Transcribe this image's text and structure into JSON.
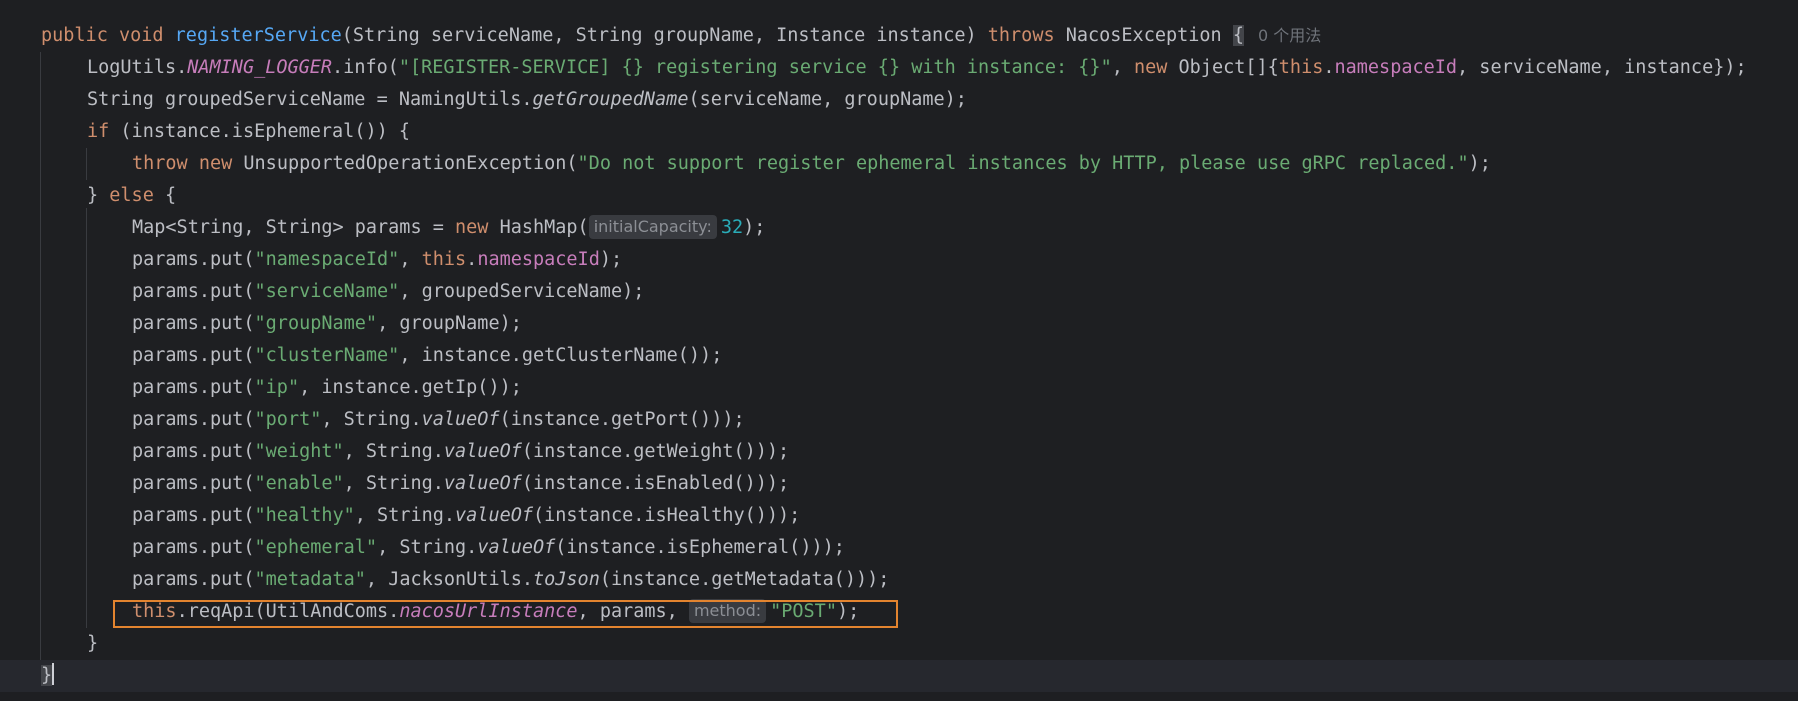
{
  "code": {
    "l1": {
      "public": "public",
      "void": "void",
      "method_name": "registerService",
      "params": "(String serviceName, String groupName, Instance instance)",
      "throws": "throws",
      "exception": "NacosException",
      "brace": "{",
      "usages": "0 个用法"
    },
    "l2": {
      "cls": "LogUtils.",
      "field": "NAMING_LOGGER",
      "call": ".info(",
      "str": "\"[REGISTER-SERVICE] {} registering service {} with instance: {}\"",
      "sep": ", ",
      "new": "new",
      "obj": "Object[]{",
      "this": "this",
      "dot": ".",
      "ns": "namespaceId",
      "rest": ", serviceName, instance});"
    },
    "l3": {
      "pre": "String groupedServiceName = NamingUtils.",
      "method": "getGroupedName",
      "post": "(serviceName, groupName);"
    },
    "l4": {
      "if": "if",
      "rest": "(instance.isEphemeral()) {"
    },
    "l5": {
      "throw": "throw",
      "new": "new",
      "exc": "UnsupportedOperationException(",
      "str": "\"Do not support register ephemeral instances by HTTP, please use gRPC replaced.\"",
      "end": ");"
    },
    "l6": {
      "brace": "}",
      "else": "else",
      "open": "{"
    },
    "l7": {
      "pre": "Map<String, String> params = ",
      "new": "new",
      "cls": "HashMap(",
      "hint": "initialCapacity:",
      "num": "32",
      "end": ");"
    },
    "l8": {
      "pre": "params.put(",
      "key": "\"namespaceId\"",
      "sep": ", ",
      "this": "this",
      "dot": ".",
      "field": "namespaceId",
      "end": ");"
    },
    "l9": {
      "pre": "params.put(",
      "key": "\"serviceName\"",
      "rest": ", groupedServiceName);"
    },
    "l10": {
      "pre": "params.put(",
      "key": "\"groupName\"",
      "rest": ", groupName);"
    },
    "l11": {
      "pre": "params.put(",
      "key": "\"clusterName\"",
      "rest": ", instance.getClusterName());"
    },
    "l12": {
      "pre": "params.put(",
      "key": "\"ip\"",
      "rest": ", instance.getIp());"
    },
    "l13": {
      "pre": "params.put(",
      "key": "\"port\"",
      "mid": ", String.",
      "method": "valueOf",
      "rest": "(instance.getPort()));"
    },
    "l14": {
      "pre": "params.put(",
      "key": "\"weight\"",
      "mid": ", String.",
      "method": "valueOf",
      "rest": "(instance.getWeight()));"
    },
    "l15": {
      "pre": "params.put(",
      "key": "\"enable\"",
      "mid": ", String.",
      "method": "valueOf",
      "rest": "(instance.isEnabled()));"
    },
    "l16": {
      "pre": "params.put(",
      "key": "\"healthy\"",
      "mid": ", String.",
      "method": "valueOf",
      "rest": "(instance.isHealthy()));"
    },
    "l17": {
      "pre": "params.put(",
      "key": "\"ephemeral\"",
      "mid": ", String.",
      "method": "valueOf",
      "rest": "(instance.isEphemeral()));"
    },
    "l18": {
      "pre": "params.put(",
      "key": "\"metadata\"",
      "mid": ", JacksonUtils.",
      "method": "toJson",
      "rest": "(instance.getMetadata()));"
    },
    "l19": {
      "this": "this",
      "mid": ".reqApi(UtilAndComs.",
      "field": "nacosUrlInstance",
      "rest": ", params, ",
      "hint": "method:",
      "str": "\"POST\"",
      "end": ");"
    },
    "l20": {
      "brace": "}"
    },
    "l21": {
      "brace": "}"
    }
  },
  "colors": {
    "background": "#1e1f22",
    "keyword": "#cf8e6d",
    "method_decl": "#56a8f5",
    "string": "#6aab73",
    "field": "#c77dbb",
    "number": "#2aacb8",
    "highlight_box": "#e3842f"
  }
}
